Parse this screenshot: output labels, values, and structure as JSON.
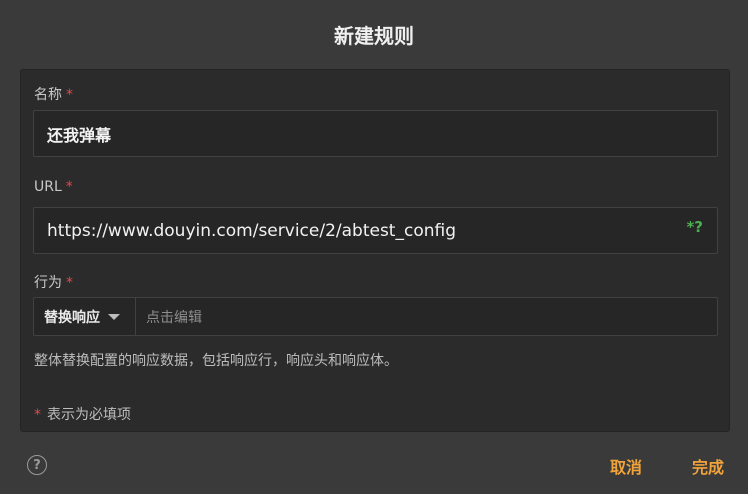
{
  "dialog": {
    "title": "新建规则"
  },
  "form": {
    "name": {
      "label": "名称",
      "required_mark": "*",
      "value": "还我弹幕"
    },
    "url": {
      "label": "URL",
      "required_mark": "*",
      "value": "https://www.douyin.com/service/2/abtest_config",
      "regex_toggle": "*?"
    },
    "action": {
      "label": "行为",
      "required_mark": "*",
      "selected": "替换响应",
      "edit_placeholder": "点击编辑",
      "description": "整体替换配置的响应数据，包括响应行，响应头和响应体。"
    },
    "required_hint": {
      "mark": "*",
      "text": "表示为必填项"
    }
  },
  "footer": {
    "help": "?",
    "cancel": "取消",
    "done": "完成"
  },
  "colors": {
    "background": "#3a3a3b",
    "panel": "#2b2b2c",
    "accent": "#f0a33a",
    "required": "#e5484d",
    "regex": "#4caf50"
  }
}
